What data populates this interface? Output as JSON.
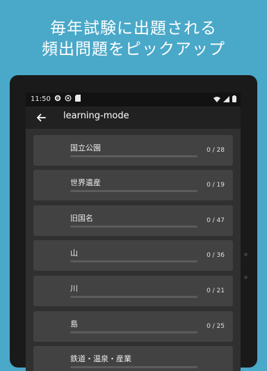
{
  "promo": {
    "line1": "毎年試験に出題される",
    "line2": "頻出問題をピックアップ"
  },
  "status_bar": {
    "time": "11:50",
    "icons": [
      "gear-icon",
      "cast-icon",
      "sd-card-icon"
    ],
    "right_icons": [
      "wifi-icon",
      "signal-icon",
      "battery-icon"
    ]
  },
  "app_bar": {
    "title": "learning-mode",
    "back_icon": "arrow-back-icon"
  },
  "categories": [
    {
      "label": "国立公園",
      "count": "0 / 28",
      "progress": 0
    },
    {
      "label": "世界遺産",
      "count": "0 / 19",
      "progress": 0
    },
    {
      "label": "旧国名",
      "count": "0 / 47",
      "progress": 0
    },
    {
      "label": "山",
      "count": "0 / 36",
      "progress": 0
    },
    {
      "label": "川",
      "count": "0 / 21",
      "progress": 0
    },
    {
      "label": "島",
      "count": "0 / 25",
      "progress": 0
    },
    {
      "label": "鉄道・温泉・産業",
      "count": "",
      "progress": 0
    }
  ],
  "colors": {
    "background": "#4aa8c8",
    "screen": "#303030",
    "card": "#424242",
    "appbar": "#212121"
  }
}
